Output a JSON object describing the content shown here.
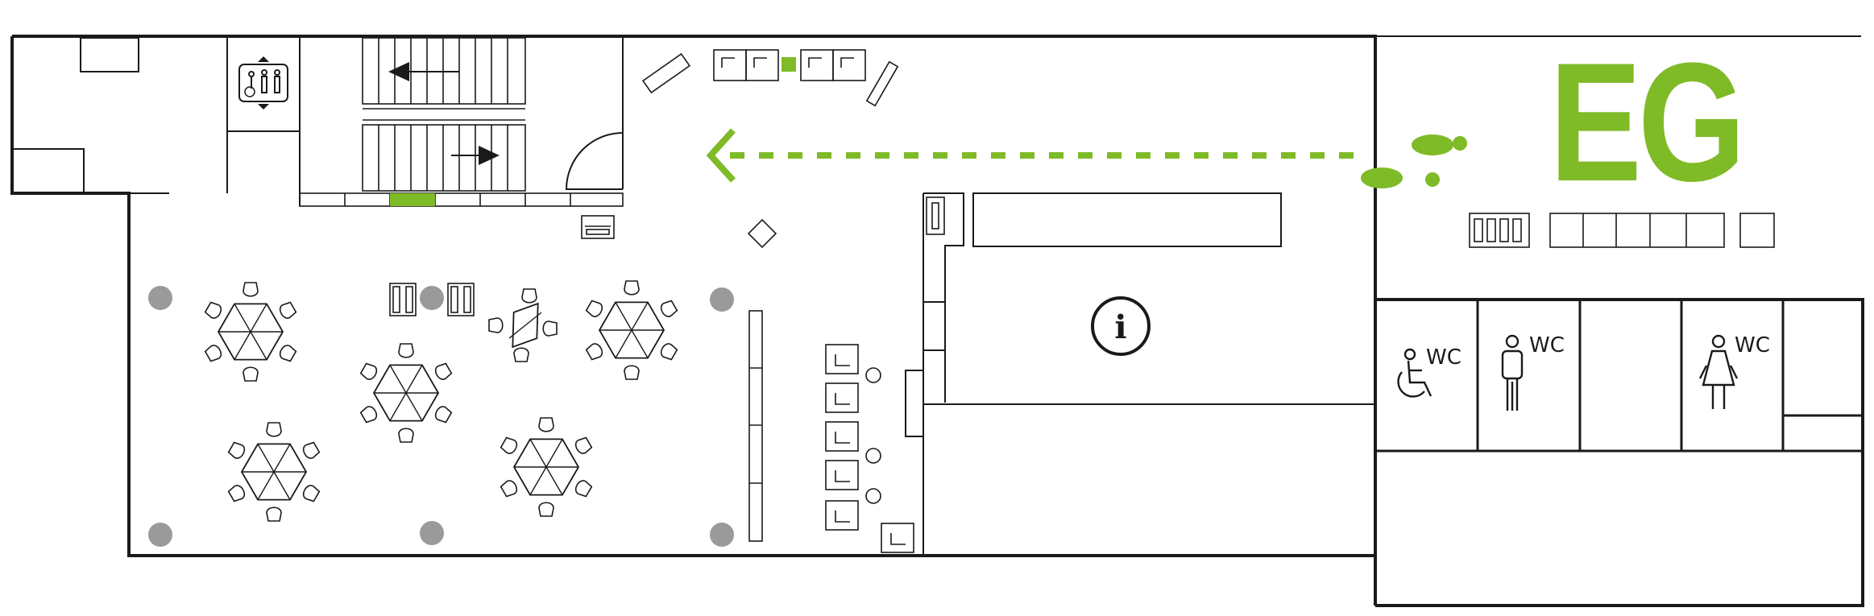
{
  "floor": {
    "label": "EG"
  },
  "colors": {
    "accent": "#7fba27",
    "wall": "#1a1a1a",
    "furniture": "#1a1a1a",
    "pillar": "#9a9a9a",
    "background": "#ffffff"
  },
  "restrooms": [
    {
      "type": "accessible",
      "label": "WC",
      "icon": "wheelchair-icon"
    },
    {
      "type": "men",
      "label": "WC",
      "icon": "man-icon"
    },
    {
      "type": "women",
      "label": "WC",
      "icon": "woman-icon"
    }
  ],
  "info_point": {
    "label": "i",
    "icon": "info-icon"
  },
  "icons": {
    "you_are_here": "footprints-icon",
    "direction": "arrow-left-icon",
    "elevator": "elevator-icon"
  }
}
